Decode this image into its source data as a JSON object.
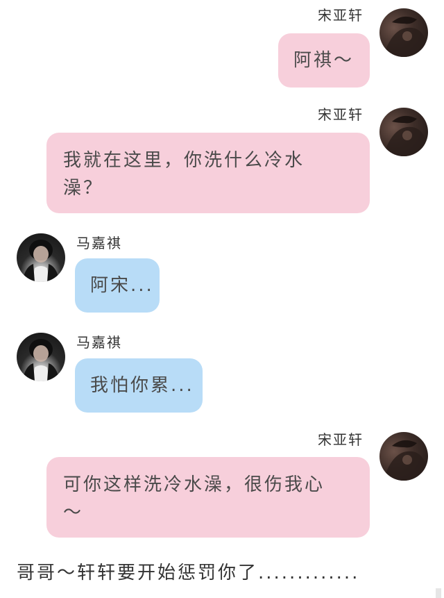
{
  "messages": [
    {
      "sender": "宋亚轩",
      "side": "right",
      "color": "pink",
      "text": "阿祺～"
    },
    {
      "sender": "宋亚轩",
      "side": "right",
      "color": "pink",
      "text": "我就在这里，你洗什么冷水澡？"
    },
    {
      "sender": "马嘉祺",
      "side": "left",
      "color": "blue",
      "text": "阿宋..."
    },
    {
      "sender": "马嘉祺",
      "side": "left",
      "color": "blue",
      "text": "我怕你累..."
    },
    {
      "sender": "宋亚轩",
      "side": "right",
      "color": "pink",
      "text": "可你这样洗冷水澡，很伤我心～"
    }
  ],
  "footer_text": "哥哥～轩轩要开始惩罚你了.............",
  "colors": {
    "pink_bubble": "#f7cfdb",
    "blue_bubble": "#b8dcf7",
    "background": "#ffffff"
  },
  "icons": {
    "right_avatar": "avatar-icon",
    "left_avatar": "avatar-icon"
  }
}
